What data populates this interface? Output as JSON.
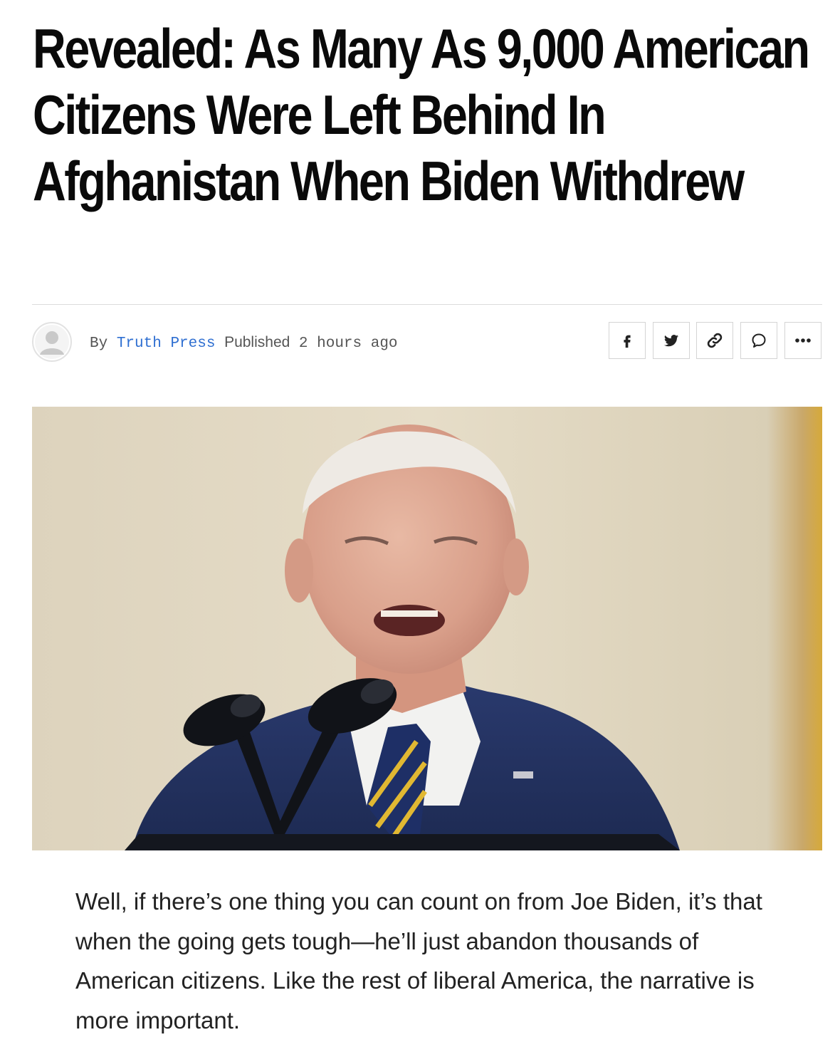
{
  "article": {
    "headline": "Revealed: As Many As 9,000 American Citizens Were Left Behind In Afghanistan When Biden Withdrew",
    "byline": {
      "by_label": "By",
      "author": "Truth Press",
      "published_label": "Published",
      "time_ago": "2 hours ago"
    },
    "share_buttons": [
      {
        "icon": "facebook-icon"
      },
      {
        "icon": "twitter-icon"
      },
      {
        "icon": "link-icon"
      },
      {
        "icon": "comment-icon"
      },
      {
        "icon": "more-icon"
      }
    ],
    "body": "Well, if there’s one thing you can count on from Joe Biden, it’s that when the going gets tough—he’ll just abandon thousands of American citizens. Like the rest of liberal America, the narrative is more important."
  },
  "colors": {
    "author_link": "#2f6fd1",
    "headline": "#0a0a0a",
    "body_text": "#222222"
  }
}
